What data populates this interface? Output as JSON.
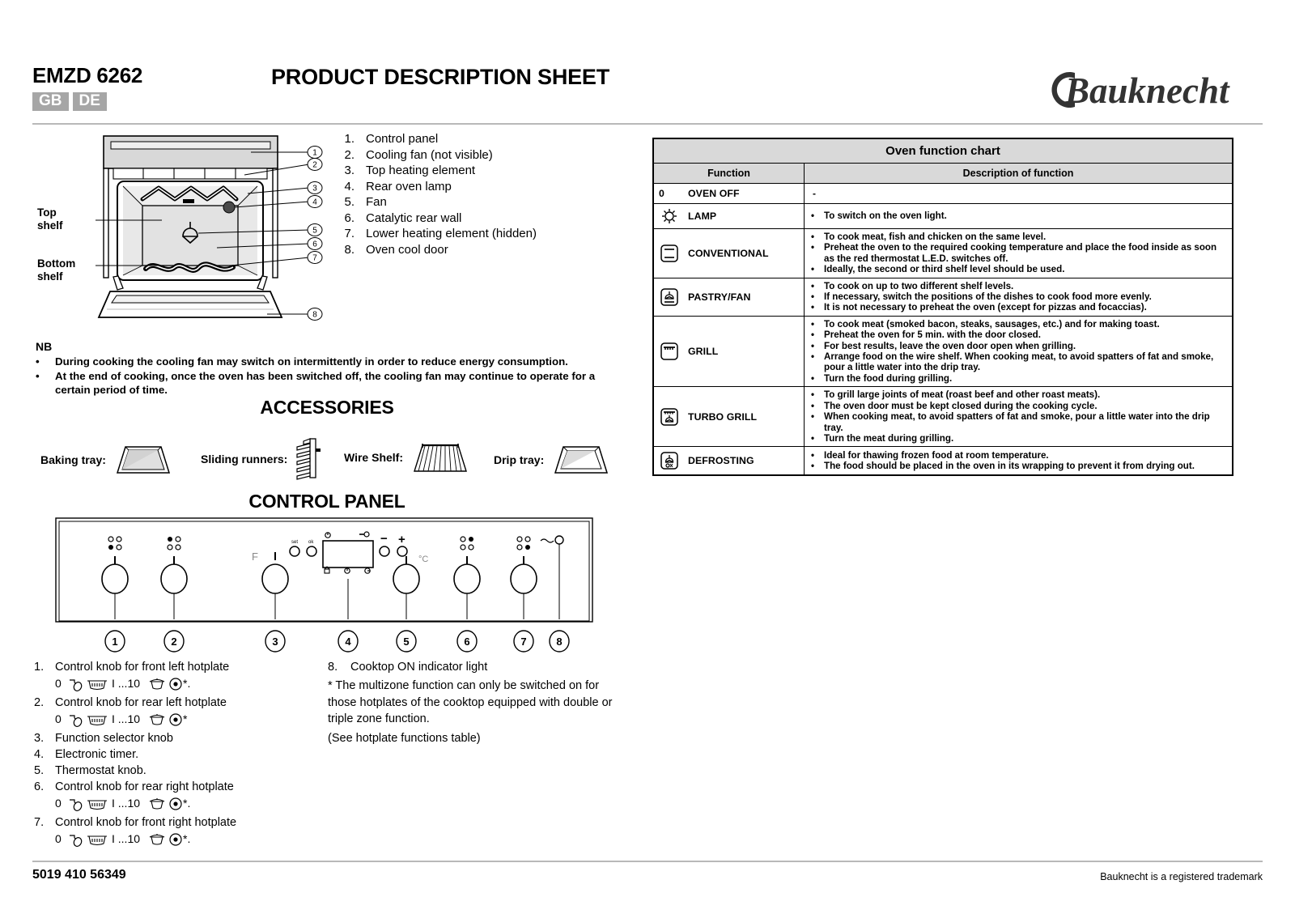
{
  "header": {
    "model": "EMZD 6262",
    "languages": [
      "GB",
      "DE"
    ],
    "doc_title": "PRODUCT DESCRIPTION SHEET",
    "brand": "Bauknecht"
  },
  "oven_diagram": {
    "top_shelf_label_line1": "Top",
    "top_shelf_label_line2": "shelf",
    "bottom_shelf_label_line1": "Bottom",
    "bottom_shelf_label_line2": "shelf",
    "callouts": [
      {
        "n": "1.",
        "label": "Control panel"
      },
      {
        "n": "2.",
        "label": "Cooling fan (not visible)"
      },
      {
        "n": "3.",
        "label": "Top heating element"
      },
      {
        "n": "4.",
        "label": "Rear oven lamp"
      },
      {
        "n": "5.",
        "label": "Fan"
      },
      {
        "n": "6.",
        "label": "Catalytic rear wall"
      },
      {
        "n": "7.",
        "label": "Lower heating element (hidden)"
      },
      {
        "n": "8.",
        "label": "Oven cool door"
      }
    ]
  },
  "nb": {
    "title": "NB",
    "items": [
      "During cooking the cooling fan may switch on intermittently in order to reduce energy consumption.",
      "At the end of cooking, once the oven has been switched off, the cooling fan may continue to operate for a certain period of time."
    ]
  },
  "accessories": {
    "title": "ACCESSORIES",
    "items": [
      {
        "label": "Baking tray:",
        "icon": "baking-tray-icon"
      },
      {
        "label": "Sliding runners:",
        "icon": "sliding-runners-icon"
      },
      {
        "label": "Wire Shelf:",
        "icon": "wire-shelf-icon"
      },
      {
        "label": "Drip tray:",
        "icon": "drip-tray-icon"
      }
    ]
  },
  "control_panel": {
    "title": "CONTROL PANEL",
    "markers": [
      "1",
      "2",
      "3",
      "4",
      "5",
      "6",
      "7",
      "8"
    ],
    "labels": {
      "f": "F",
      "set": "set",
      "ok": "ok",
      "minus": "−",
      "plus": "+",
      "celsius": "°C"
    },
    "left_list": [
      {
        "n": "1.",
        "text": "Control knob for front left hotplate",
        "symbols": "0 ... I ...10 ... *."
      },
      {
        "n": "2.",
        "text": "Control knob for rear left hotplate",
        "symbols": "0 ... I ...10 ... *"
      },
      {
        "n": "3.",
        "text": "Function selector knob",
        "symbols": ""
      },
      {
        "n": "4.",
        "text": "Electronic timer.",
        "symbols": ""
      },
      {
        "n": "5.",
        "text": "Thermostat knob.",
        "symbols": ""
      },
      {
        "n": "6.",
        "text": "Control knob for rear right hotplate",
        "symbols": "0 ... I ...10 ... *."
      },
      {
        "n": "7.",
        "text": "Control knob for front right hotplate",
        "symbols": "0 ... I ...10 ... *."
      }
    ],
    "symbol_parts": {
      "zero": "0",
      "range": "I ...10",
      "star": "*."
    },
    "right_list": [
      {
        "n": "8.",
        "text": "Cooktop ON indicator light"
      }
    ],
    "footnote": "* The multizone function can only be switched on for those hotplates of the cooktop equipped with double or triple zone function.",
    "footnote2": "(See hotplate functions table)"
  },
  "table": {
    "title": "Oven function chart",
    "col_function": "Function",
    "col_description": "Description of function",
    "rows": [
      {
        "icon": "zero-icon",
        "prefix": "0",
        "name": "OVEN OFF",
        "dash": "-",
        "bullets": []
      },
      {
        "icon": "lamp-icon",
        "prefix": "",
        "name": "LAMP",
        "bullets": [
          "To switch on the oven light."
        ]
      },
      {
        "icon": "conventional-icon",
        "prefix": "",
        "name": "CONVENTIONAL",
        "bullets": [
          "To cook meat, fish and chicken on the same level.",
          "Preheat the oven to the required cooking temperature and place the food inside as soon as the red thermostat L.E.D. switches off.",
          "Ideally, the second or third shelf level should be used."
        ]
      },
      {
        "icon": "pastry-fan-icon",
        "prefix": "",
        "name": "PASTRY/FAN",
        "bullets": [
          "To cook on up to two different shelf levels.",
          "If necessary, switch the positions of the dishes to cook food more evenly.",
          "It is not necessary to preheat the oven (except for pizzas and focaccias)."
        ]
      },
      {
        "icon": "grill-icon",
        "prefix": "",
        "name": "GRILL",
        "bullets": [
          "To cook meat (smoked bacon, steaks, sausages, etc.) and for making toast.",
          "Preheat the oven for 5 min. with the door closed.",
          "For best results, leave the oven door open when grilling.",
          "Arrange food on the wire shelf. When cooking meat, to avoid spatters of fat and smoke, pour a little water into the drip tray.",
          "Turn the food during grilling."
        ]
      },
      {
        "icon": "turbo-grill-icon",
        "prefix": "",
        "name": "TURBO GRILL",
        "bullets": [
          "To grill large joints of meat (roast beef and other roast meats).",
          "The oven door must be kept closed during the cooking cycle.",
          "When cooking meat, to avoid spatters of fat and smoke, pour a little water into the drip tray.",
          "Turn the meat during grilling."
        ]
      },
      {
        "icon": "defrosting-icon",
        "prefix": "",
        "name": "DEFROSTING",
        "bullets": [
          "Ideal for thawing frozen food at room temperature.",
          "The food should be placed in the oven in its wrapping to prevent it from drying out."
        ]
      }
    ]
  },
  "footer": {
    "code": "5019 410 56349",
    "trademark": "Bauknecht is a registered trademark"
  }
}
